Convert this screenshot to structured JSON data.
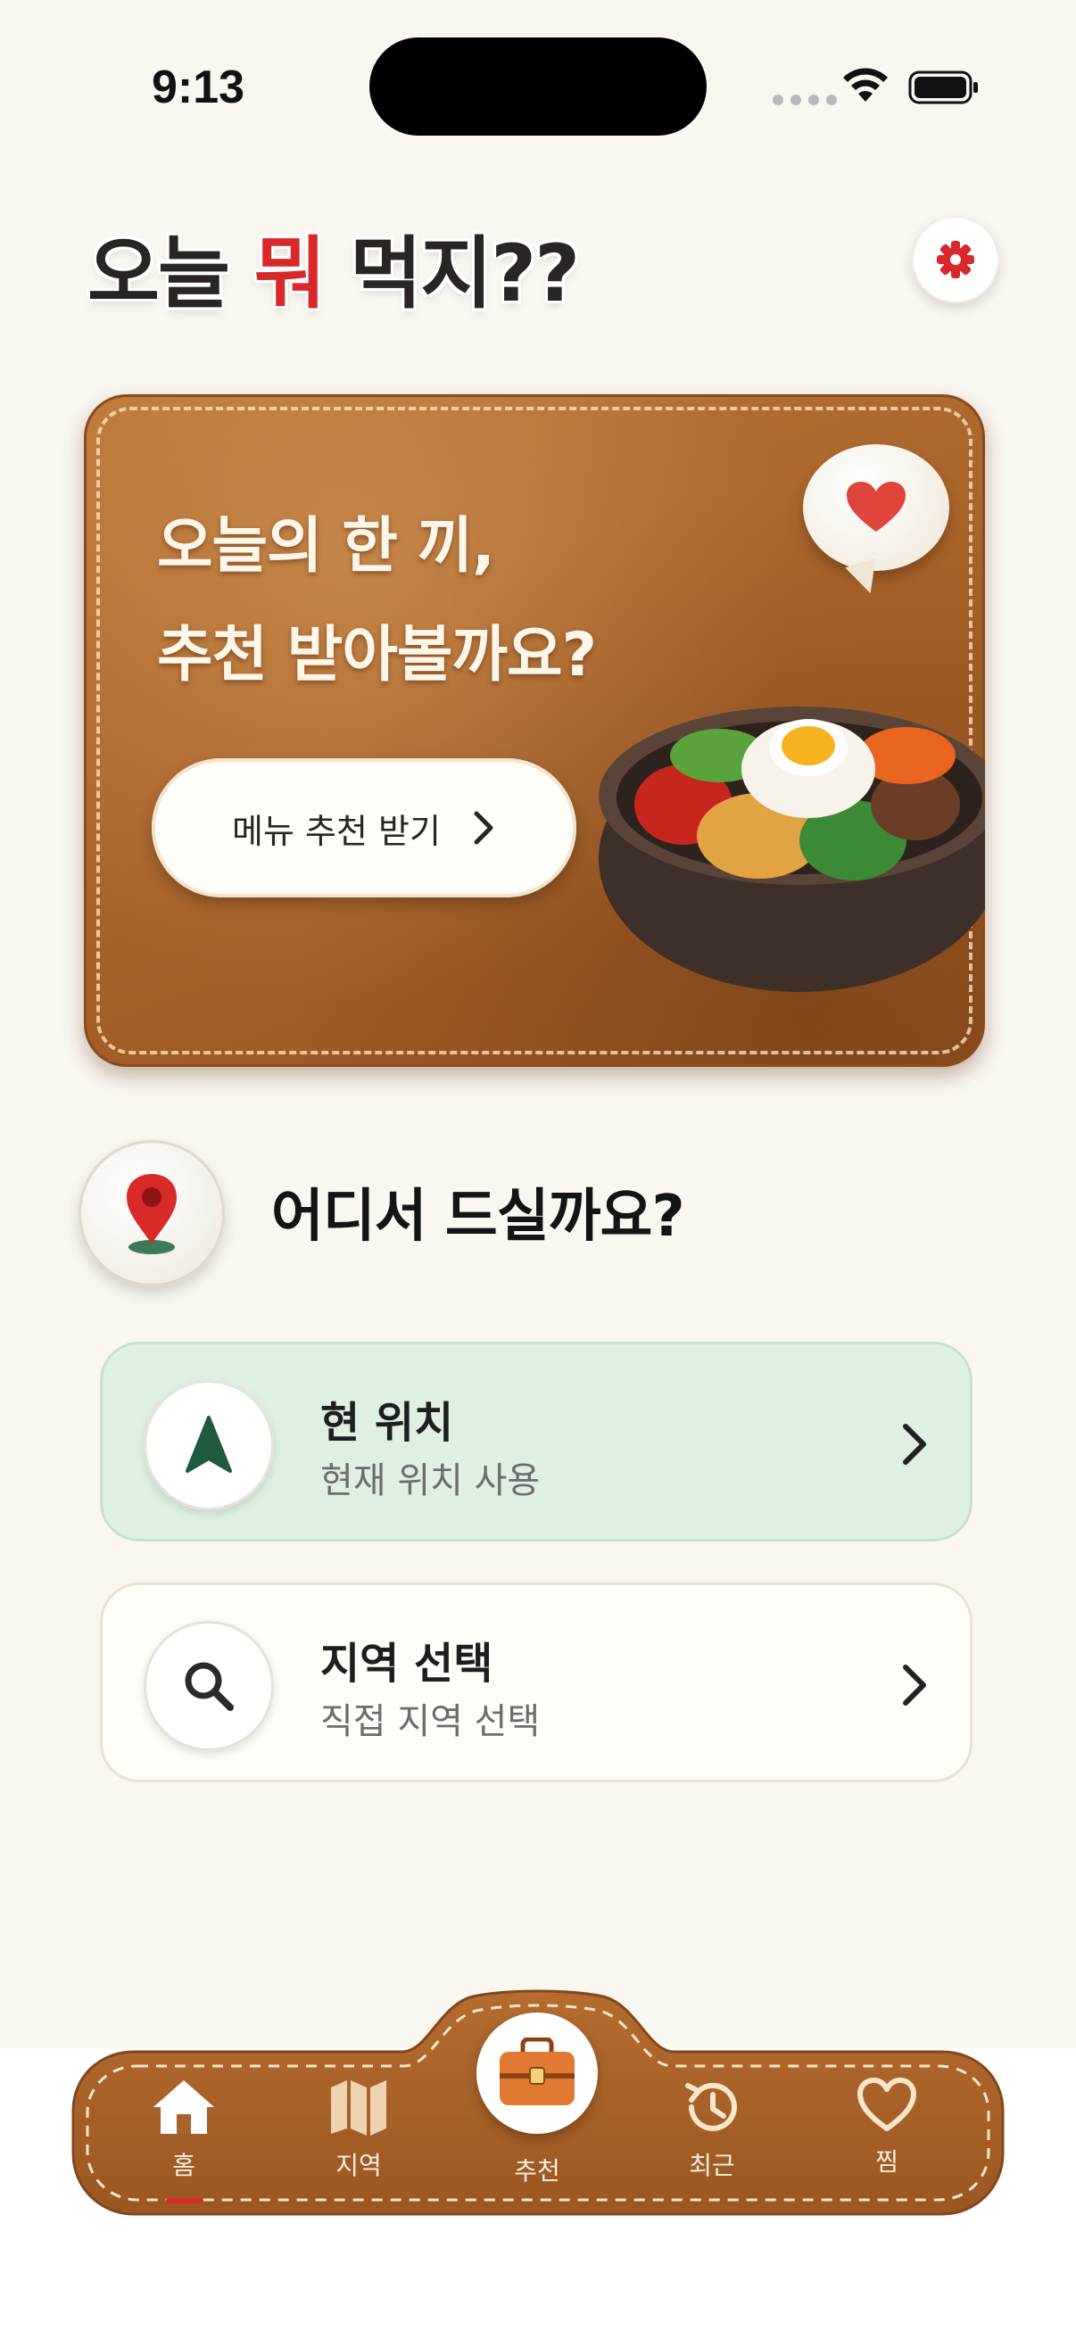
{
  "status_bar": {
    "time": "9:13"
  },
  "header": {
    "title_prefix": "오늘 ",
    "title_accent": "뭐",
    "title_suffix": " 먹지??"
  },
  "hero": {
    "line1": "오늘의 한 끼,",
    "line2": "추천 받아볼까요?",
    "cta_label": "메뉴 추천 받기"
  },
  "location": {
    "title": "어디서 드실까요?",
    "options": [
      {
        "title": "현 위치",
        "subtitle": "현재 위치 사용"
      },
      {
        "title": "지역 선택",
        "subtitle": "직접 지역 선택"
      }
    ]
  },
  "tabs": [
    {
      "label": "홈",
      "icon": "home-icon",
      "active": true
    },
    {
      "label": "지역",
      "icon": "map-icon",
      "active": false
    },
    {
      "label": "추천",
      "icon": "toolbox-icon",
      "active": false
    },
    {
      "label": "최근",
      "icon": "history-icon",
      "active": false
    },
    {
      "label": "찜",
      "icon": "heart-icon",
      "active": false
    }
  ],
  "colors": {
    "background": "#faf7f1",
    "accent_red": "#d8282b",
    "leather": "#a8632a",
    "current_location_card": "#ddf0e2",
    "location_arrow": "#1e5a3e"
  }
}
